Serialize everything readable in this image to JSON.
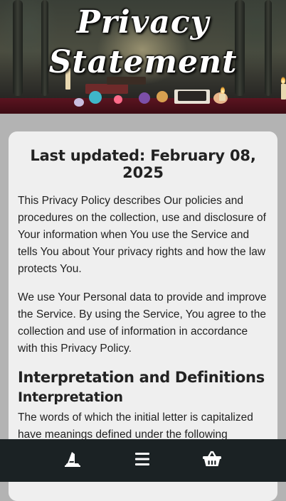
{
  "hero": {
    "title_line1": "Privacy",
    "title_line2": "Statement"
  },
  "content": {
    "last_updated": "Last updated: February 08, 2025",
    "paragraph1": "This Privacy Policy describes Our policies and procedures on the collection, use and disclosure of Your information when You use the Service and tells You about Your privacy rights and how the law protects You.",
    "paragraph2": "We use Your Personal data to provide and improve the Service. By using the Service, You agree to the collection and use of information in accordance with this Privacy Policy.",
    "heading_interpretation_definitions": "Interpretation and Definitions",
    "heading_interpretation": "Interpretation",
    "paragraph3": "The words of which the initial letter is capitalized have meanings defined under the following conditions."
  },
  "bottom_nav": {
    "items": [
      {
        "icon": "witch-hat-icon"
      },
      {
        "icon": "menu-icon"
      },
      {
        "icon": "basket-icon"
      }
    ],
    "background": "#1b2224",
    "icon_color": "#ffffff"
  },
  "colors": {
    "page_background": "#b3b3b3",
    "card_background": "#efefef",
    "text": "#222222"
  }
}
